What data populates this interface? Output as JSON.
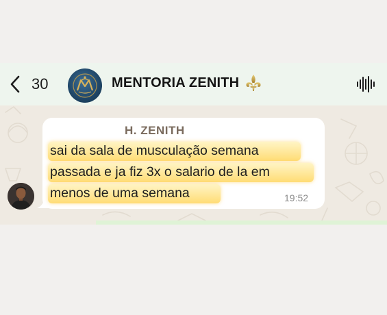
{
  "header": {
    "back_count": "30",
    "group_name": "MENTORIA ZENITH",
    "fleur_glyph": "⚜"
  },
  "message": {
    "sender": "H. ZENITH",
    "lines": [
      "sai da sala de musculação semana",
      "passada e ja fiz 3x o salario de la em",
      "menos de uma semana"
    ],
    "time": "19:52"
  },
  "colors": {
    "header_bg": "#eef5ee",
    "chat_bg": "#efeae2",
    "highlight": "#ffd65c",
    "sender": "#7a6b5e"
  },
  "icons": {
    "back": "chevron-left-icon",
    "audio": "audio-wave-icon",
    "fleur": "fleur-de-lis-icon"
  }
}
